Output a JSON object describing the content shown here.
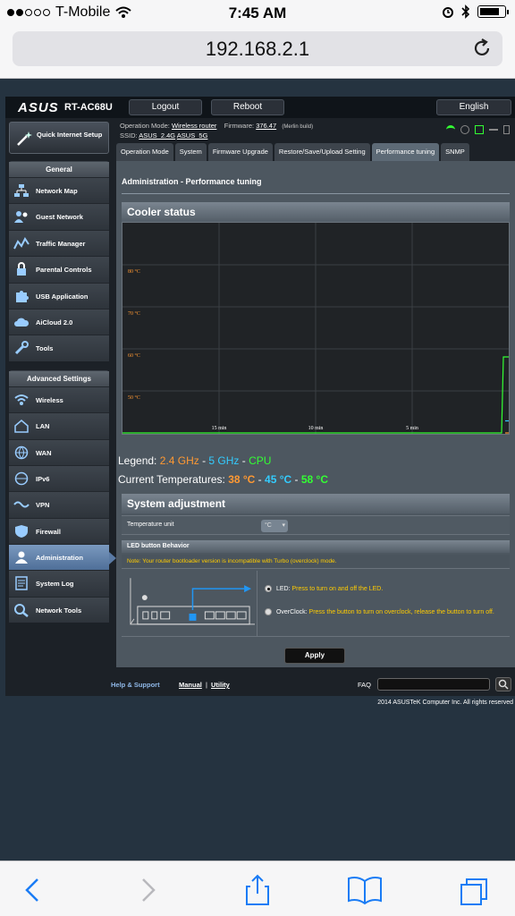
{
  "status": {
    "carrier": "T-Mobile",
    "time": "7:45 AM"
  },
  "browser": {
    "url": "192.168.2.1"
  },
  "router": {
    "brand": "ASUS",
    "model": "RT-AC68U",
    "logout": "Logout",
    "reboot": "Reboot",
    "language": "English",
    "operation_mode_label": "Operation Mode:",
    "operation_mode": "Wireless router",
    "firmware_label": "Firmware:",
    "firmware": "376.47",
    "build": "(Merlin build)",
    "ssid_label": "SSID:",
    "ssid_24": "ASUS_2.4G",
    "ssid_5": "ASUS_5G"
  },
  "sidebar": {
    "qis_label": "Quick Internet Setup",
    "general_header": "General",
    "general": [
      "Network Map",
      "Guest Network",
      "Traffic Manager",
      "Parental Controls",
      "USB Application",
      "AiCloud 2.0",
      "Tools"
    ],
    "advanced_header": "Advanced Settings",
    "advanced": [
      "Wireless",
      "LAN",
      "WAN",
      "IPv6",
      "VPN",
      "Firewall",
      "Administration",
      "System Log",
      "Network Tools"
    ]
  },
  "tabs": [
    "Operation Mode",
    "System",
    "Firmware Upgrade",
    "Restore/Save/Upload Setting",
    "Performance tuning",
    "SNMP"
  ],
  "page": {
    "title": "Administration - Performance tuning",
    "cooler_header": "Cooler status",
    "legend_label": "Legend:",
    "legend_24": "2.4 GHz",
    "legend_5": "5 GHz",
    "legend_cpu": "CPU",
    "current_label": "Current Temperatures:",
    "temp_24": "38 °C",
    "temp_5": "45 °C",
    "temp_cpu": "58 °C",
    "adjust_header": "System adjustment",
    "temp_unit_label": "Temperature unit",
    "temp_unit_value": "°C",
    "led_header": "LED button Behavior",
    "note": "Note: Your router bootloader version is incompatible with Turbo (overclock) mode.",
    "led_option": "LED:",
    "led_desc": "Press to turn on and off the LED.",
    "oc_option": "OverClock:",
    "oc_desc": "Press the button to turn on overclock, release the button to turn off.",
    "apply": "Apply"
  },
  "footer": {
    "help": "Help & Support",
    "manual": "Manual",
    "utility": "Utility",
    "faq": "FAQ",
    "copyright": "2014 ASUSTeK Computer Inc. All rights reserved"
  },
  "chart_data": {
    "type": "line",
    "y_ticks": [
      "80 °C",
      "70 °C",
      "60 °C",
      "50 °C"
    ],
    "x_ticks": [
      "15 min",
      "10 min",
      "5 min"
    ],
    "series": [
      {
        "name": "2.4 GHz",
        "color": "#ff9933",
        "values": [
          38
        ]
      },
      {
        "name": "5 GHz",
        "color": "#33ccff",
        "values": [
          45
        ]
      },
      {
        "name": "CPU",
        "color": "#33ff33",
        "values": [
          58
        ]
      }
    ]
  }
}
